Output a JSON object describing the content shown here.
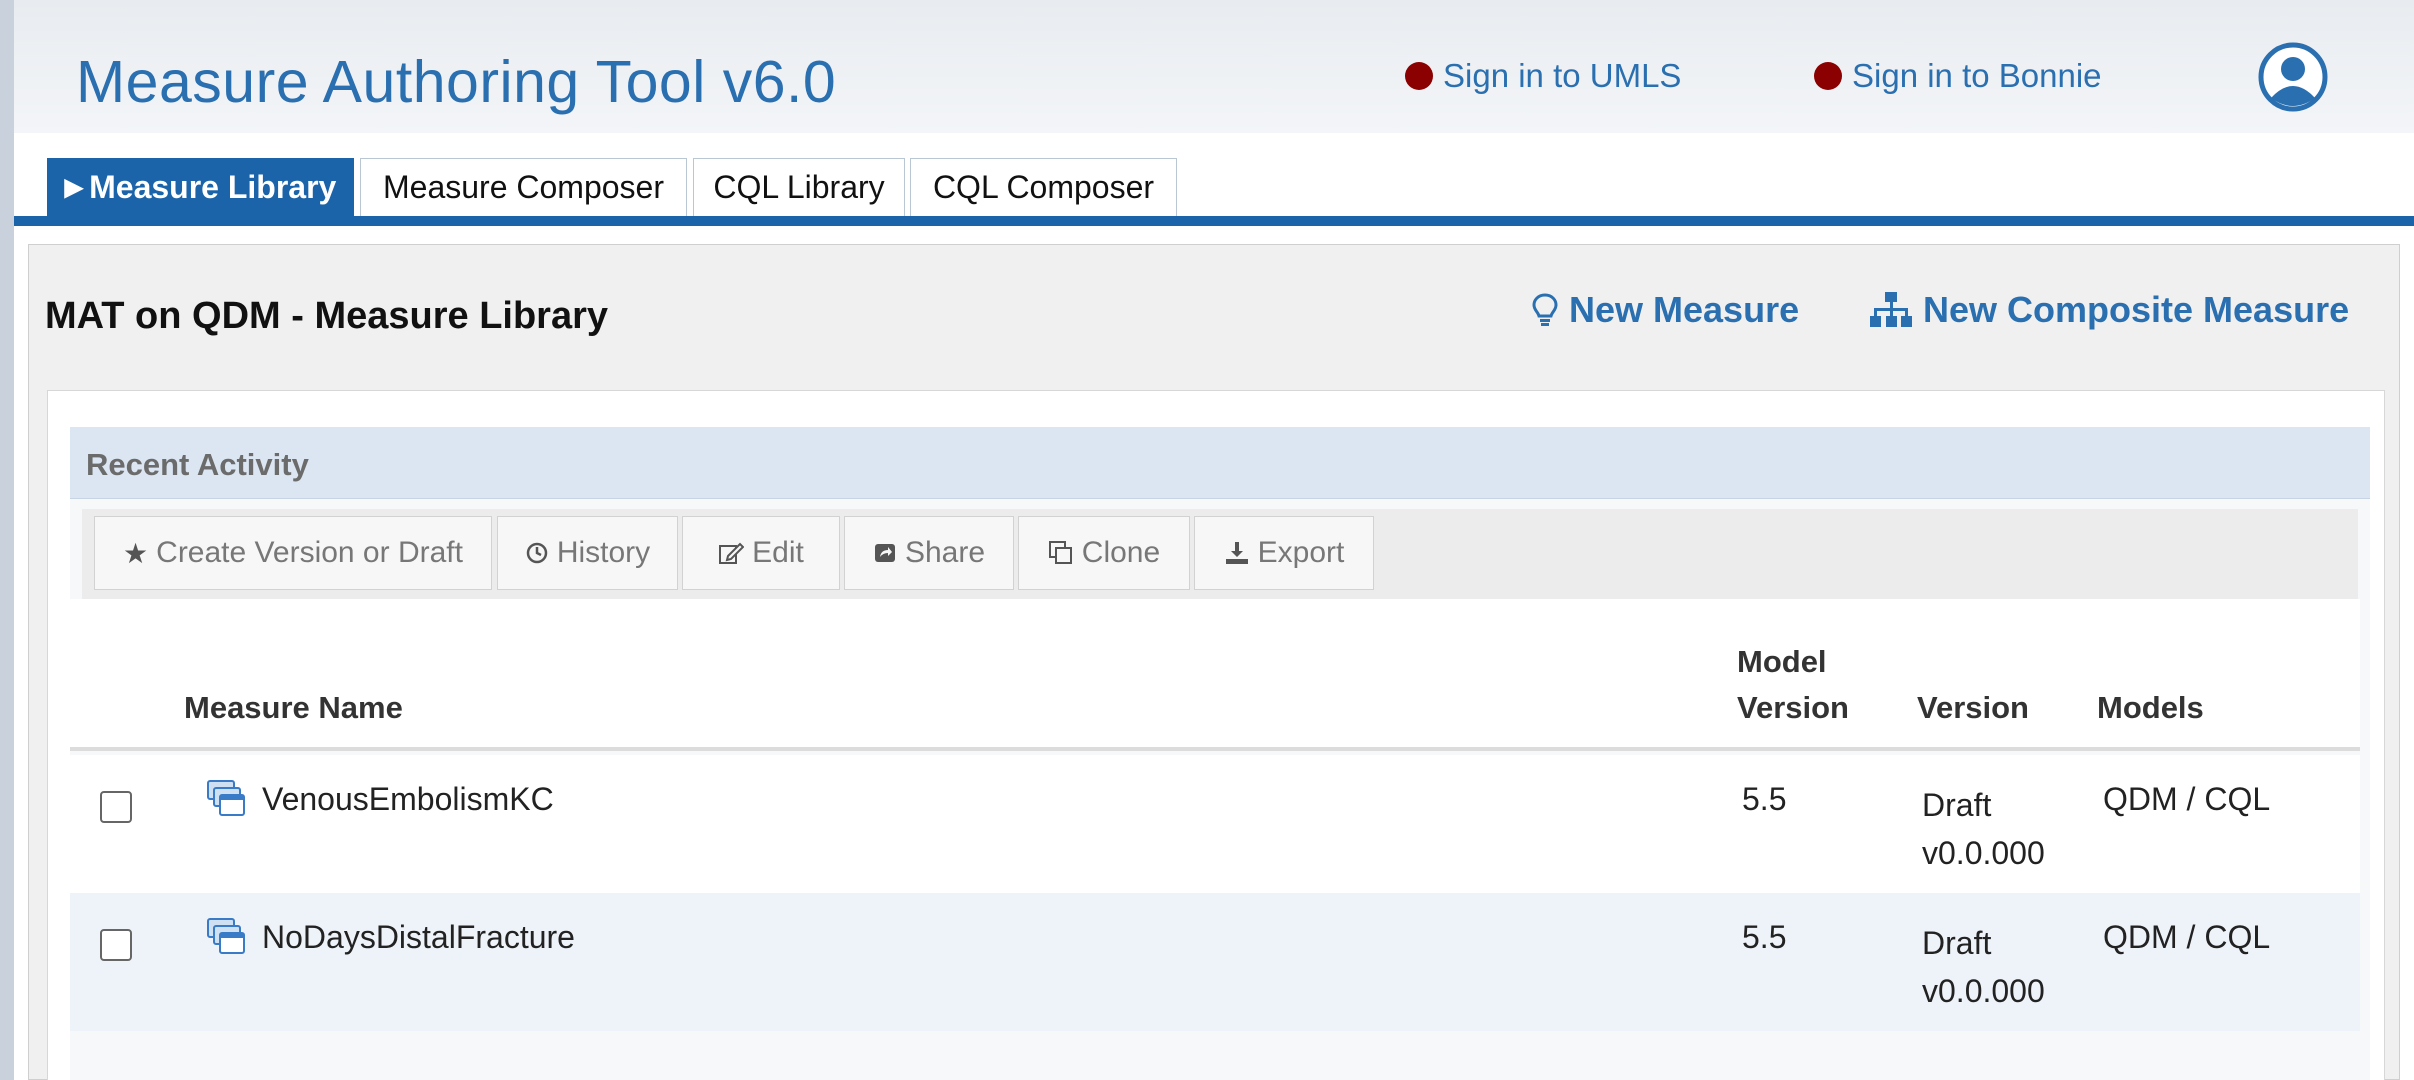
{
  "header": {
    "title": "Measure Authoring Tool v6.0",
    "signin_umls": "Sign in to UMLS",
    "signin_bonnie": "Sign in to Bonnie",
    "status_color": "#8b0000",
    "accent_color": "#2a6fb0"
  },
  "tabs": [
    {
      "label": "Measure Library",
      "active": true
    },
    {
      "label": "Measure Composer",
      "active": false
    },
    {
      "label": "CQL Library",
      "active": false
    },
    {
      "label": "CQL Composer",
      "active": false
    }
  ],
  "panel": {
    "title": "MAT on QDM - Measure Library",
    "new_measure": "New Measure",
    "new_composite": "New Composite Measure"
  },
  "recent": {
    "heading": "Recent Activity",
    "toolbar": {
      "create": "Create Version or Draft",
      "history": "History",
      "edit": "Edit",
      "share": "Share",
      "clone": "Clone",
      "export": "Export"
    },
    "columns": {
      "name": "Measure Name",
      "model_version": "Model Version",
      "version": "Version",
      "models": "Models"
    },
    "rows": [
      {
        "name": "VenousEmbolismKC",
        "model_version": "5.5",
        "version": "Draft v0.0.000",
        "models": "QDM / CQL"
      },
      {
        "name": "NoDaysDistalFracture",
        "model_version": "5.5",
        "version": "Draft v0.0.000",
        "models": "QDM / CQL"
      }
    ]
  }
}
